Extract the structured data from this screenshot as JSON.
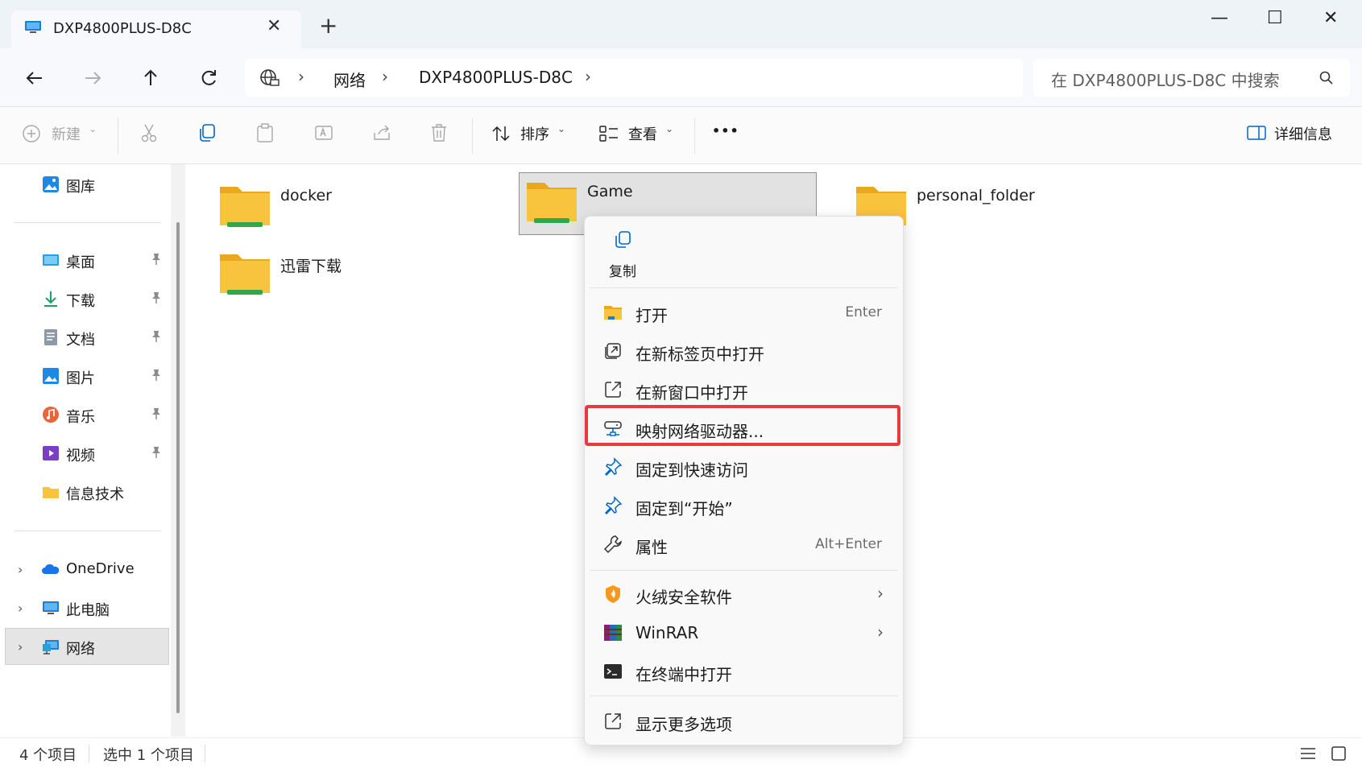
{
  "window": {
    "tab_title": "DXP4800PLUS-D8C",
    "tab_close": "✕",
    "new_tab": "+",
    "minimize": "—",
    "maximize": "☐",
    "close": "✕"
  },
  "address": {
    "breadcrumbs": [
      "网络",
      "DXP4800PLUS-D8C"
    ],
    "separator": "›",
    "search_placeholder": "在 DXP4800PLUS-D8C 中搜索"
  },
  "toolbar": {
    "new_label": "新建",
    "sort_label": "排序",
    "view_label": "查看",
    "more_label": "•••",
    "details_label": "详细信息"
  },
  "sidebar": {
    "gallery": "图库",
    "quick": [
      {
        "label": "桌面",
        "icon": "desktop-icon"
      },
      {
        "label": "下载",
        "icon": "download-icon"
      },
      {
        "label": "文档",
        "icon": "documents-icon"
      },
      {
        "label": "图片",
        "icon": "pictures-icon"
      },
      {
        "label": "音乐",
        "icon": "music-icon"
      },
      {
        "label": "视频",
        "icon": "videos-icon"
      },
      {
        "label": "信息技术",
        "icon": "folder-icon"
      }
    ],
    "onedrive": "OneDrive",
    "thispc": "此电脑",
    "network": "网络",
    "expand": "›"
  },
  "files": [
    {
      "name": "docker"
    },
    {
      "name": "Game",
      "selected": true
    },
    {
      "name": "personal_folder"
    },
    {
      "name": "迅雷下载"
    }
  ],
  "status": {
    "count": "4 个项目",
    "selected": "选中 1 个项目"
  },
  "context_menu": {
    "copy_label": "复制",
    "items": [
      {
        "label": "打开",
        "shortcut": "Enter",
        "icon": "folder-open-icon"
      },
      {
        "label": "在新标签页中打开",
        "icon": "new-tab-icon"
      },
      {
        "label": "在新窗口中打开",
        "icon": "new-window-icon"
      },
      {
        "label": "映射网络驱动器...",
        "icon": "map-drive-icon",
        "highlighted": true
      },
      {
        "label": "固定到快速访问",
        "icon": "pin-icon"
      },
      {
        "label": "固定到“开始”",
        "icon": "pin-icon"
      },
      {
        "label": "属性",
        "shortcut": "Alt+Enter",
        "icon": "wrench-icon"
      },
      {
        "label": "火绒安全软件",
        "submenu": true,
        "icon": "huorong-icon"
      },
      {
        "label": "WinRAR",
        "submenu": true,
        "icon": "winrar-icon"
      },
      {
        "label": "在终端中打开",
        "icon": "terminal-icon"
      },
      {
        "label": "显示更多选项",
        "icon": "more-options-icon"
      }
    ]
  },
  "colors": {
    "accent": "#0067c0",
    "highlight_border": "#e8393f",
    "folder": "#f8c33d",
    "folder_share": "#2ea84a"
  }
}
